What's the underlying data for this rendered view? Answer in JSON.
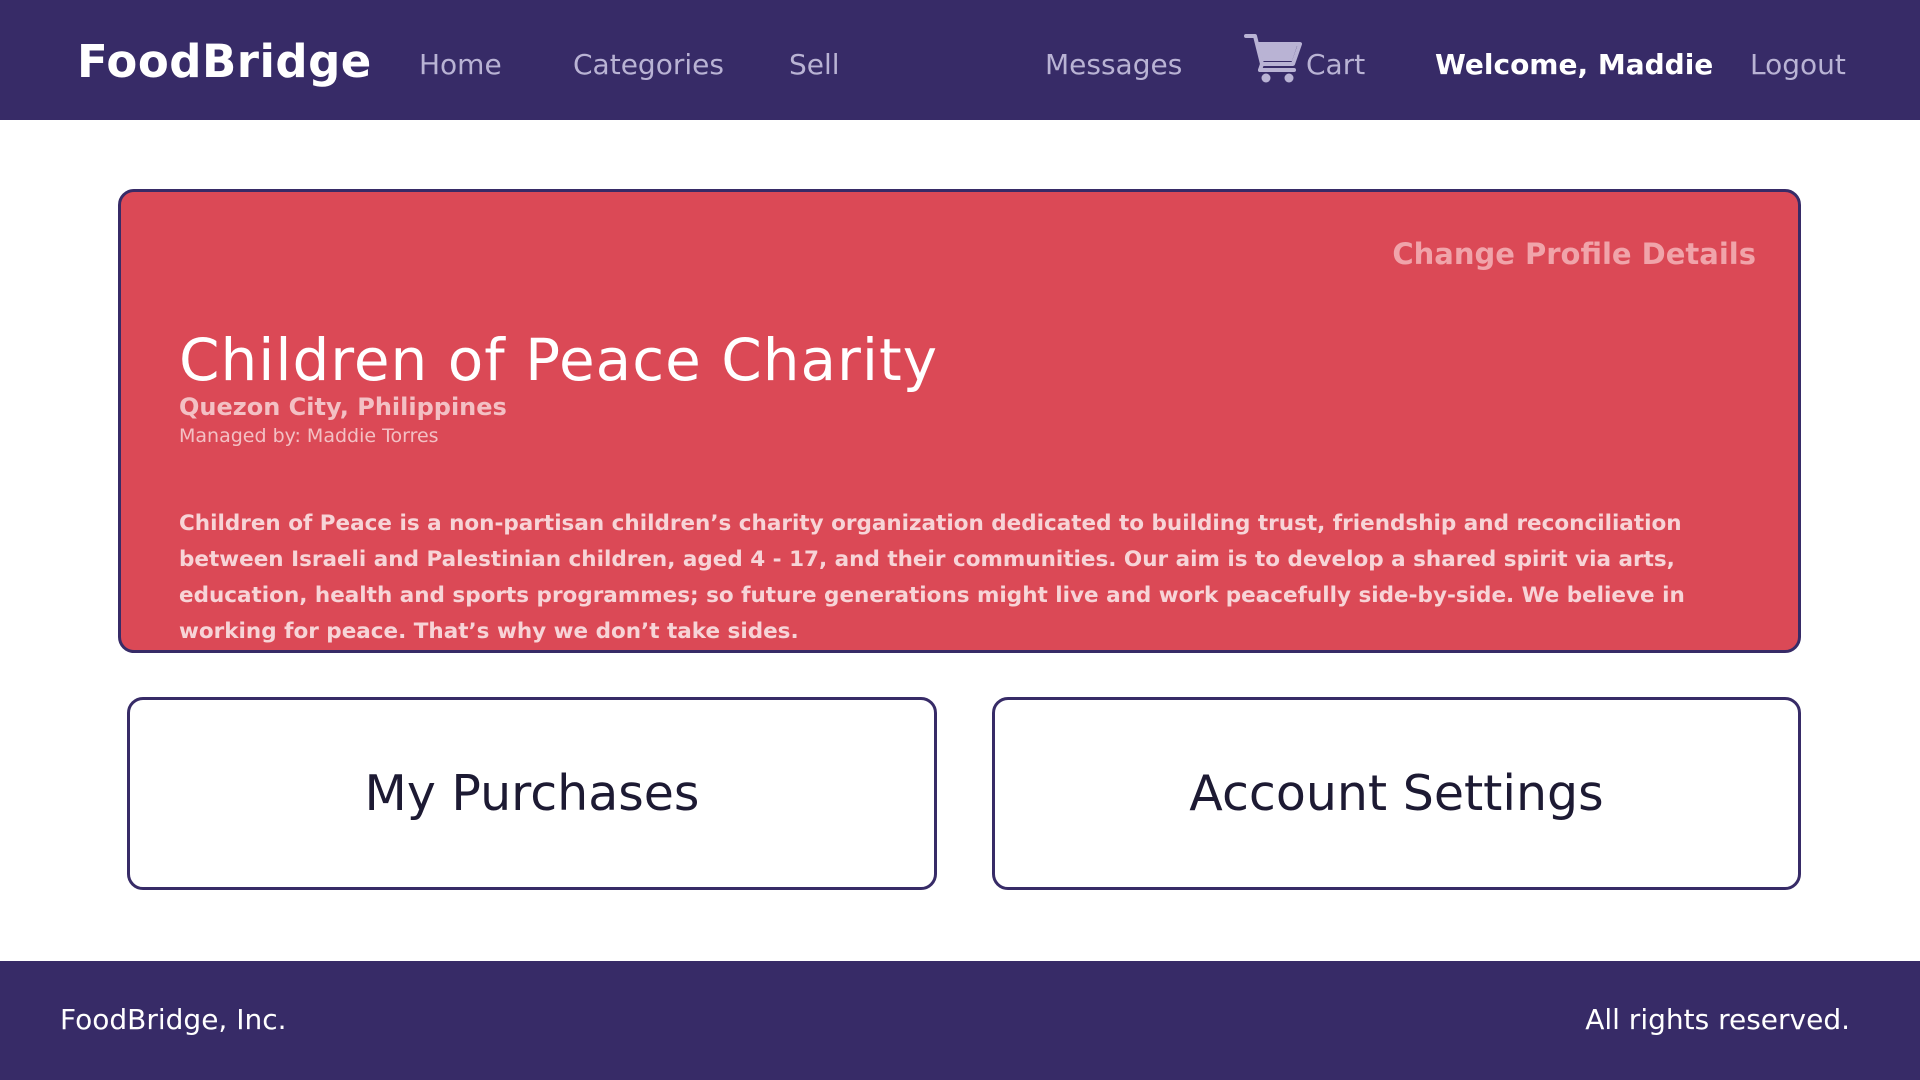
{
  "navbar": {
    "brand": "FoodBridge",
    "links": {
      "home": "Home",
      "categories": "Categories",
      "sell": "Sell",
      "messages": "Messages",
      "cart": "Cart",
      "logout": "Logout"
    },
    "welcome": "Welcome, Maddie",
    "cart_icon": "cart-icon"
  },
  "profile": {
    "change_link": "Change Profile Details",
    "name": "Children of Peace Charity",
    "location": "Quezon City, Philippines",
    "manager": "Managed by: Maddie Torres",
    "description": "Children of Peace is a non-partisan children’s charity organization dedicated to building trust, friendship and reconciliation between Israeli and Palestinian children, aged 4 - 17, and their communities. Our aim is to develop a shared spirit via arts, education, health and sports programmes; so future generations might live and work peacefully side-by-side. We believe in working for peace. That’s why we don’t take sides."
  },
  "tiles": {
    "purchases": "My Purchases",
    "settings": "Account Settings"
  },
  "footer": {
    "company": "FoodBridge, Inc.",
    "rights": "All rights reserved."
  },
  "colors": {
    "nav_bg": "#372b67",
    "card_bg": "#db4956",
    "nav_link": "#b9b3d4"
  }
}
